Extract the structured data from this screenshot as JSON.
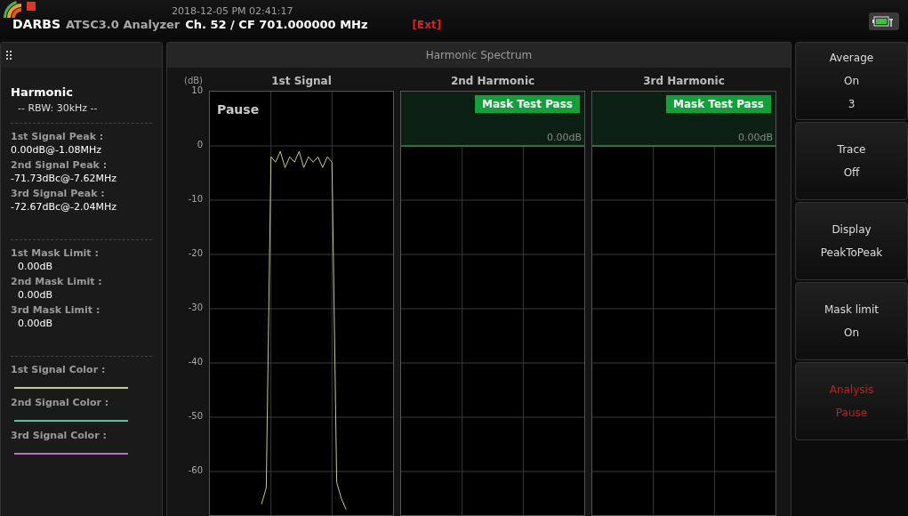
{
  "header": {
    "logo_text": "DARBS",
    "app_name": "ATSC3.0 Analyzer",
    "datetime": "2018-12-05 PM 02:41:17",
    "channel": "Ch. 52 / CF 701.000000 MHz",
    "ext": "[Ext]"
  },
  "left_panel": {
    "title": "Harmonic",
    "rbw": "-- RBW: 30kHz --",
    "peaks": [
      {
        "label": "1st Signal Peak :",
        "value": "0.00dB@-1.08MHz"
      },
      {
        "label": "2nd Signal Peak :",
        "value": "-71.73dBc@-7.62MHz"
      },
      {
        "label": "3rd Signal Peak :",
        "value": "-72.67dBc@-2.04MHz"
      }
    ],
    "mask_limits": [
      {
        "label": "1st Mask Limit :",
        "value": "0.00dB"
      },
      {
        "label": "2nd Mask Limit :",
        "value": "0.00dB"
      },
      {
        "label": "3rd Mask Limit :",
        "value": "0.00dB"
      }
    ],
    "signal_colors": [
      {
        "label": "1st Signal Color :",
        "color": "#c8c896"
      },
      {
        "label": "2nd Signal Color :",
        "color": "#5fc0a8"
      },
      {
        "label": "3rd Signal Color :",
        "color": "#c070c0"
      }
    ]
  },
  "spectrum": {
    "title": "Harmonic Spectrum",
    "panels": [
      {
        "kind": "signal",
        "status": "Pause"
      },
      {
        "title": "2nd Harmonic",
        "kind": "mask",
        "badge": "Mask Test Pass",
        "mask_value": "0.00dB"
      },
      {
        "title": "3rd Harmonic",
        "kind": "mask",
        "badge": "Mask Test Pass",
        "mask_value": "0.00dB"
      }
    ],
    "chart_data": {
      "type": "line",
      "grid": true,
      "ylabel": "(dB)",
      "ylim": [
        -68,
        10
      ],
      "yticks": [
        10,
        0,
        -10,
        -20,
        -30,
        -40,
        -50,
        -60
      ],
      "series": [
        {
          "name": "1st Signal",
          "color": "#c8c896",
          "values": [
            null,
            null,
            null,
            null,
            null,
            null,
            null,
            null,
            null,
            null,
            null,
            -66,
            -63,
            -2,
            -3,
            -1,
            -4,
            -2,
            -3,
            -1,
            -4,
            -2,
            -3,
            -2,
            -4,
            -2,
            -3,
            -62,
            -65,
            -67,
            null,
            null,
            null,
            null,
            null,
            null,
            null,
            null,
            null,
            null
          ]
        }
      ]
    }
  },
  "softkeys": [
    {
      "lines": [
        "Average",
        "On",
        "3"
      ],
      "active": false
    },
    {
      "lines": [
        "Trace",
        "Off"
      ],
      "active": false
    },
    {
      "lines": [
        "Display",
        "PeakToPeak"
      ],
      "active": false
    },
    {
      "lines": [
        "Mask limit",
        "On"
      ],
      "active": false
    },
    {
      "lines": [
        "Analysis",
        "Pause"
      ],
      "active": true
    }
  ]
}
